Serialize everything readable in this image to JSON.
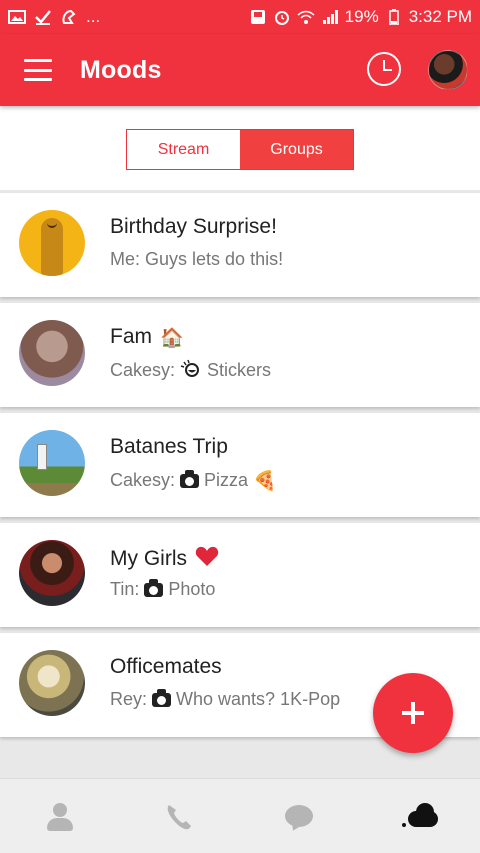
{
  "status_bar": {
    "left_icons": [
      "gallery-icon",
      "check-icon",
      "notification-icon",
      "more-icon"
    ],
    "more_text": "...",
    "right_icons": [
      "save-icon",
      "alarm-icon",
      "wifi-icon",
      "signal-icon",
      "battery-icon"
    ],
    "battery": "19%",
    "time": "3:32 PM"
  },
  "app_bar": {
    "title": "Moods",
    "menu_icon": "hamburger-menu-icon",
    "history_icon": "clock-icon"
  },
  "tabs": [
    {
      "label": "Stream",
      "active": false
    },
    {
      "label": "Groups",
      "active": true
    }
  ],
  "groups": [
    {
      "name": "Birthday Surprise!",
      "sender": "Me:",
      "message": "Guys lets do this!",
      "name_emoji": "",
      "media_icon": "",
      "message_emoji": ""
    },
    {
      "name": "Fam",
      "name_emoji": "🏠",
      "sender": "Cakesy:",
      "media_icon": "sticker-icon",
      "message": "Stickers",
      "message_emoji": ""
    },
    {
      "name": "Batanes Trip",
      "name_emoji": "",
      "sender": "Cakesy:",
      "media_icon": "camera-icon",
      "message": "Pizza",
      "message_emoji": "🍕"
    },
    {
      "name": "My Girls",
      "name_emoji": "❤️",
      "sender": "Tin:",
      "media_icon": "camera-icon",
      "message": "Photo",
      "message_emoji": ""
    },
    {
      "name": "Officemates",
      "name_emoji": "",
      "sender": "Rey:",
      "media_icon": "camera-icon",
      "message": "Who wants? 1K-Pop",
      "message_emoji": ""
    }
  ],
  "fab": {
    "icon": "plus-icon"
  },
  "bottom_nav": [
    {
      "icon": "person-icon",
      "active": false
    },
    {
      "icon": "phone-icon",
      "active": false
    },
    {
      "icon": "chat-icon",
      "active": false
    },
    {
      "icon": "cloud-icon",
      "active": true
    }
  ],
  "colors": {
    "accent": "#f0323f",
    "text": "#222222",
    "subtext": "#777777",
    "background": "#e8e8e8"
  }
}
